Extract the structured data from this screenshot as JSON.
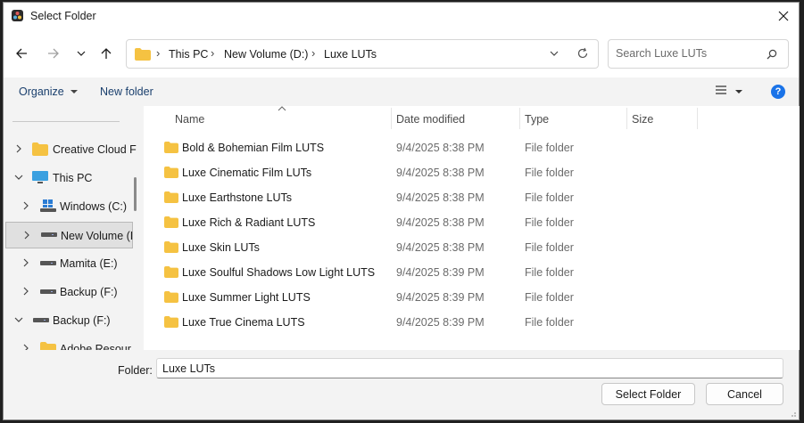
{
  "window": {
    "title": "Select Folder",
    "app_icon": "davinci-resolve-icon"
  },
  "breadcrumb": [
    "This PC",
    "New Volume (D:)",
    "Luxe LUTs"
  ],
  "search": {
    "placeholder": "Search Luxe LUTs"
  },
  "toolbar": {
    "organize": "Organize",
    "new_folder": "New folder"
  },
  "nav": {
    "items": [
      {
        "label": "Creative Cloud F",
        "icon": "cloud-folder-icon",
        "expanded": false
      },
      {
        "label": "This PC",
        "icon": "pc-icon",
        "expanded": true
      },
      {
        "label": "Windows (C:)",
        "icon": "windows-drive-icon",
        "expanded": false
      },
      {
        "label": "New Volume (I",
        "icon": "drive-icon",
        "expanded": false,
        "selected": true
      },
      {
        "label": "Mamita (E:)",
        "icon": "drive-icon",
        "expanded": false
      },
      {
        "label": "Backup  (F:)",
        "icon": "drive-icon",
        "expanded": false
      },
      {
        "label": "Backup  (F:)",
        "icon": "drive-icon",
        "expanded": true
      },
      {
        "label": "Adobe Resour",
        "icon": "folder-icon",
        "expanded": false
      }
    ]
  },
  "columns": {
    "name": "Name",
    "date": "Date modified",
    "type": "Type",
    "size": "Size"
  },
  "files": [
    {
      "name": "Bold & Bohemian Film LUTS",
      "date": "9/4/2025 8:38 PM",
      "type": "File folder"
    },
    {
      "name": "Luxe Cinematic Film LUTs",
      "date": "9/4/2025 8:38 PM",
      "type": "File folder"
    },
    {
      "name": "Luxe Earthstone LUTs",
      "date": "9/4/2025 8:38 PM",
      "type": "File folder"
    },
    {
      "name": "Luxe Rich & Radiant LUTS",
      "date": "9/4/2025 8:38 PM",
      "type": "File folder"
    },
    {
      "name": "Luxe Skin LUTs",
      "date": "9/4/2025 8:38 PM",
      "type": "File folder"
    },
    {
      "name": "Luxe Soulful Shadows Low Light LUTS",
      "date": "9/4/2025 8:39 PM",
      "type": "File folder"
    },
    {
      "name": "Luxe Summer Light LUTS",
      "date": "9/4/2025 8:39 PM",
      "type": "File folder"
    },
    {
      "name": "Luxe True Cinema LUTS",
      "date": "9/4/2025 8:39 PM",
      "type": "File folder"
    }
  ],
  "footer": {
    "folder_label": "Folder:",
    "folder_value": "Luxe LUTs",
    "select_button": "Select Folder",
    "cancel_button": "Cancel"
  },
  "colors": {
    "accent": "#1a73e8",
    "folder": "#f5c242",
    "link": "#1a3f6d"
  }
}
